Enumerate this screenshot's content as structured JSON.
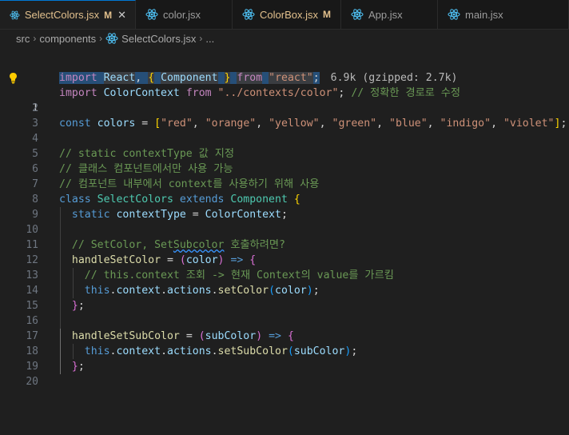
{
  "tabs": [
    {
      "label": "SelectColors.jsx",
      "mark": "M",
      "active": true,
      "modified": true,
      "icon": "react-icon"
    },
    {
      "label": "color.jsx",
      "mark": "",
      "active": false,
      "modified": false,
      "icon": "react-icon"
    },
    {
      "label": "ColorBox.jsx",
      "mark": "M",
      "active": false,
      "modified": true,
      "icon": "react-icon"
    },
    {
      "label": "App.jsx",
      "mark": "",
      "active": false,
      "modified": false,
      "icon": "react-icon"
    },
    {
      "label": "main.jsx",
      "mark": "",
      "active": false,
      "modified": false,
      "icon": "react-icon"
    }
  ],
  "breadcrumb": {
    "items": [
      "src",
      "components",
      "SelectColors.jsx",
      "..."
    ]
  },
  "editor": {
    "import_hint": "6.9k (gzipped: 2.7k)",
    "lines": [
      {
        "n": 1,
        "text": "import React, { Component } from \"react\";"
      },
      {
        "n": 2,
        "text": "import ColorContext from \"../contexts/color\"; // 정확한 경로로 수정"
      },
      {
        "n": 3,
        "text": ""
      },
      {
        "n": 4,
        "text": "const colors = [\"red\", \"orange\", \"yellow\", \"green\", \"blue\", \"indigo\", \"violet\"];"
      },
      {
        "n": 5,
        "text": ""
      },
      {
        "n": 6,
        "text": "// static contextType 값 지정"
      },
      {
        "n": 7,
        "text": "// 클래스 컴포넌트에서만 사용 가능"
      },
      {
        "n": 8,
        "text": "// 컴포넌트 내부에서 context를 사용하기 위해 사용"
      },
      {
        "n": 9,
        "text": "class SelectColors extends Component {"
      },
      {
        "n": 10,
        "text": "  static contextType = ColorContext;"
      },
      {
        "n": 11,
        "text": ""
      },
      {
        "n": 12,
        "text": "  // SetColor, SetSubcolor 호출하려면?"
      },
      {
        "n": 13,
        "text": "  handleSetColor = (color) => {"
      },
      {
        "n": 14,
        "text": "    // this.context 조회 -> 현재 Context의 value를 가르킴"
      },
      {
        "n": 15,
        "text": "    this.context.actions.setColor(color);"
      },
      {
        "n": 16,
        "text": "  };"
      },
      {
        "n": 17,
        "text": ""
      },
      {
        "n": 18,
        "text": "  handleSetSubColor = (subColor) => {"
      },
      {
        "n": 19,
        "text": "    this.context.actions.setSubColor(subColor);"
      },
      {
        "n": 20,
        "text": "  };"
      }
    ]
  },
  "colors": {
    "keyword": "#569cd6",
    "control": "#c586c0",
    "variable": "#9cdcfe",
    "class": "#4ec9b0",
    "function": "#dcdcaa",
    "string": "#ce9178",
    "comment": "#6a9955",
    "modified": "#e2c08d",
    "accent": "#0078d4"
  }
}
